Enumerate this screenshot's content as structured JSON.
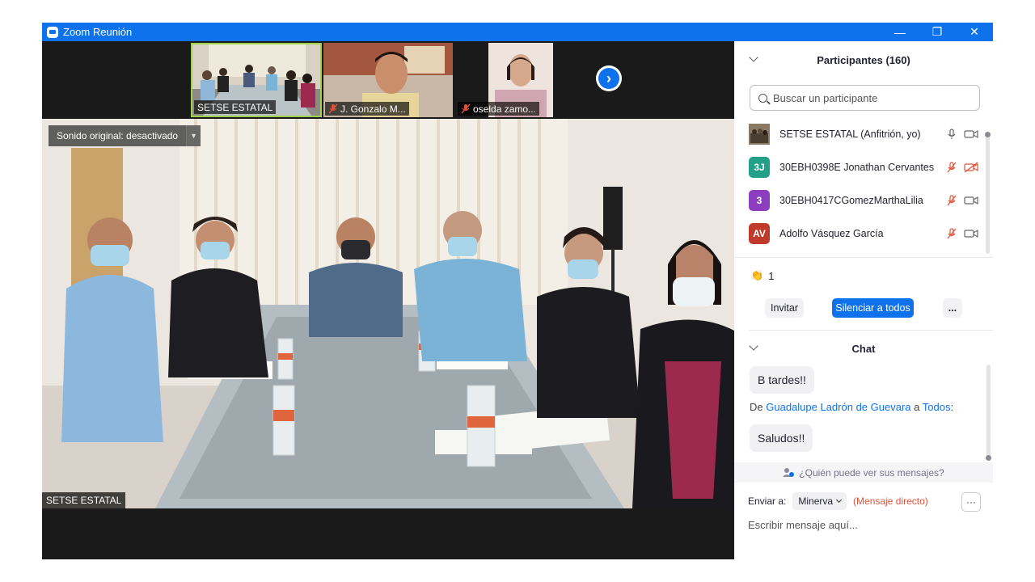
{
  "window": {
    "title": "Zoom Reunión"
  },
  "titlebar": {
    "minimize": "—",
    "restore": "❐",
    "close": "✕"
  },
  "video_strip": {
    "thumbnails": [
      {
        "label": "SETSE ESTATAL",
        "muted": false
      },
      {
        "label": "J. Gonzalo M...",
        "muted": true
      },
      {
        "label": "oselda zamo...",
        "muted": true
      }
    ],
    "next_arrow": "›"
  },
  "main_video": {
    "original_sound": "Sonido original: desactivado",
    "label": "SETSE ESTATAL"
  },
  "participants_panel": {
    "title": "Participantes (160)",
    "search_placeholder": "Buscar un participante",
    "participants": [
      {
        "initials": "",
        "name": "SETSE ESTATAL (Anfitrión, yo)",
        "avatar_color": "#6b5a44",
        "mic": "on",
        "video": "on"
      },
      {
        "initials": "3J",
        "name": "30EBH0398E Jonathan Cervantes",
        "avatar_color": "#23a08a",
        "mic": "off",
        "video": "off"
      },
      {
        "initials": "3",
        "name": "30EBH0417CGomezMarthaLilia",
        "avatar_color": "#8b3fbf",
        "mic": "off",
        "video": "on"
      },
      {
        "initials": "AV",
        "name": "Adolfo Vásquez García",
        "avatar_color": "#c03a2b",
        "mic": "off",
        "video": "on"
      }
    ],
    "reactions": {
      "emoji": "👏",
      "count": "1"
    },
    "buttons": {
      "invite": "Invitar",
      "mute_all": "Silenciar a todos",
      "more": "..."
    }
  },
  "chat_panel": {
    "title": "Chat",
    "messages": [
      {
        "text": "B tardes!!"
      },
      {
        "from_prefix": "De",
        "from": "Guadalupe Ladrón de Guevara",
        "to_prefix": "a",
        "to": "Todos",
        "suffix": ":",
        "text": "Saludos!!"
      }
    ],
    "who_can_see": "¿Quién puede ver sus mensajes?",
    "send_to_label": "Enviar a:",
    "recipient": "Minerva",
    "direct_message": "(Mensaje directo)",
    "more": "···",
    "compose_placeholder": "Escribir mensaje aquí..."
  },
  "colors": {
    "zoom_blue": "#0e72ed",
    "active_speaker": "#9dd24a",
    "muted_red": "#e0523a"
  }
}
